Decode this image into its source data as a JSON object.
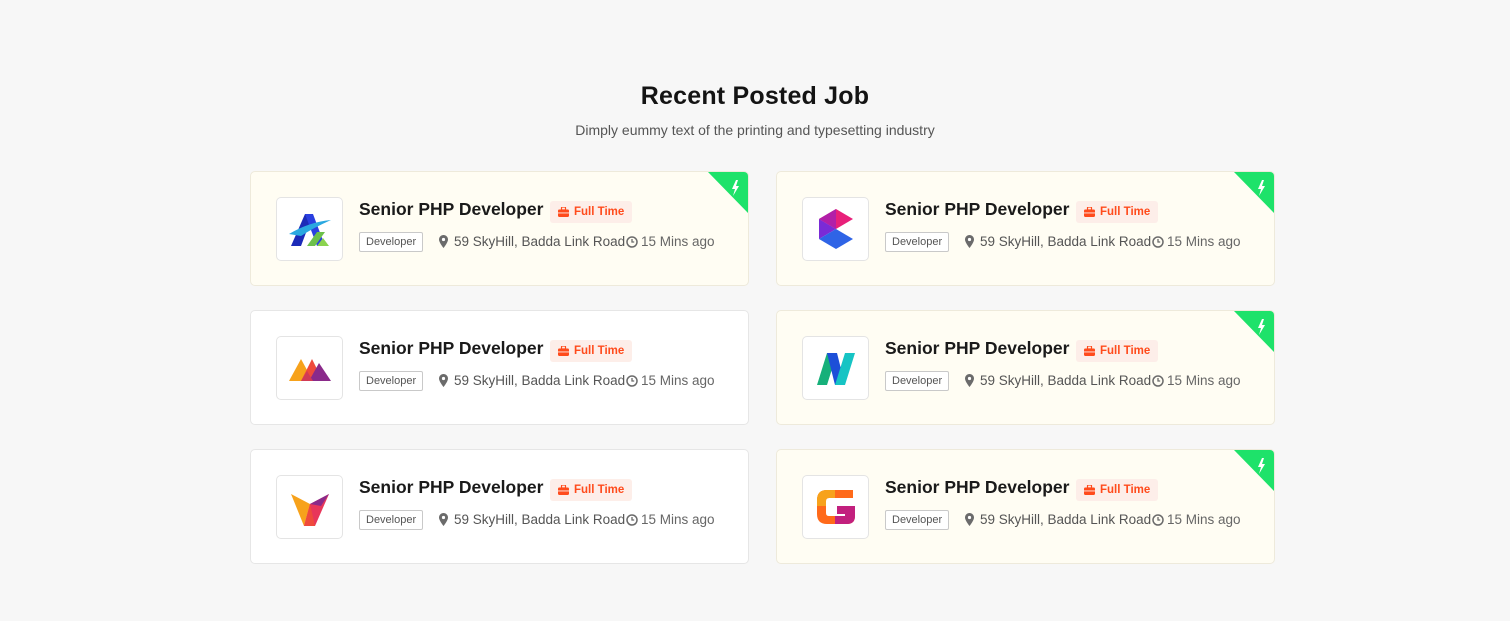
{
  "section": {
    "title": "Recent Posted Job",
    "subtitle": "Dimply eummy text of the printing and typesetting industry"
  },
  "jobs": [
    {
      "title": "Senior PHP Developer",
      "type": "Full Time",
      "category": "Developer",
      "location": "59 SkyHill, Badda Link Road",
      "posted": "15 Mins ago",
      "featured": true,
      "logo": "logo-a-icon"
    },
    {
      "title": "Senior PHP Developer",
      "type": "Full Time",
      "category": "Developer",
      "location": "59 SkyHill, Badda Link Road",
      "posted": "15 Mins ago",
      "featured": true,
      "logo": "logo-e-icon"
    },
    {
      "title": "Senior PHP Developer",
      "type": "Full Time",
      "category": "Developer",
      "location": "59 SkyHill, Badda Link Road",
      "posted": "15 Mins ago",
      "featured": false,
      "logo": "logo-mountain-icon"
    },
    {
      "title": "Senior PHP Developer",
      "type": "Full Time",
      "category": "Developer",
      "location": "59 SkyHill, Badda Link Road",
      "posted": "15 Mins ago",
      "featured": true,
      "logo": "logo-n-icon"
    },
    {
      "title": "Senior PHP Developer",
      "type": "Full Time",
      "category": "Developer",
      "location": "59 SkyHill, Badda Link Road",
      "posted": "15 Mins ago",
      "featured": false,
      "logo": "logo-v-icon"
    },
    {
      "title": "Senior PHP Developer",
      "type": "Full Time",
      "category": "Developer",
      "location": "59 SkyHill, Badda Link Road",
      "posted": "15 Mins ago",
      "featured": true,
      "logo": "logo-g-icon"
    }
  ],
  "colors": {
    "page_bg": "#f7f7f7",
    "featured_bg": "#fffdf3",
    "badge_text": "#ff4b1c",
    "badge_bg": "#fdeee9",
    "ribbon": "#1ee26a"
  }
}
